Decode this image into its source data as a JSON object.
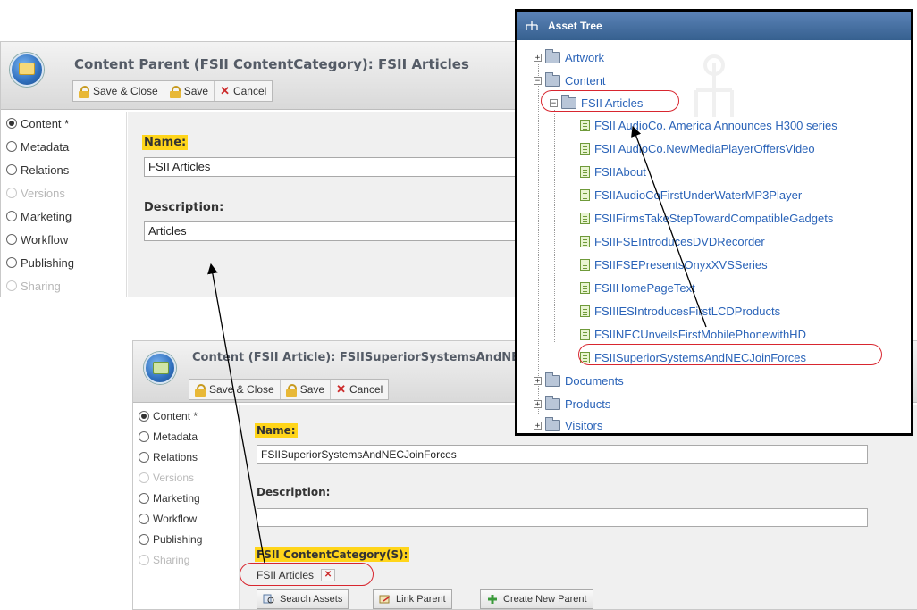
{
  "parent_panel": {
    "title": "Content Parent (FSII ContentCategory): FSII Articles",
    "toolbar": {
      "save_close": "Save & Close",
      "save": "Save",
      "cancel": "Cancel"
    },
    "tabs": [
      "Content *",
      "Metadata",
      "Relations",
      "Versions",
      "Marketing",
      "Workflow",
      "Publishing",
      "Sharing"
    ],
    "name_label": "Name:",
    "name_value": "FSII Articles",
    "description_label": "Description:",
    "description_value": "Articles"
  },
  "article_panel": {
    "title": "Content (FSII Article): FSIISuperiorSystemsAndNECJoinForces",
    "toolbar": {
      "save_close": "Save & Close",
      "save": "Save",
      "cancel": "Cancel"
    },
    "tabs": [
      "Content *",
      "Metadata",
      "Relations",
      "Versions",
      "Marketing",
      "Workflow",
      "Publishing",
      "Sharing"
    ],
    "name_label": "Name:",
    "name_value": "FSIISuperiorSystemsAndNECJoinForces",
    "description_label": "Description:",
    "description_value": "",
    "category_label": "FSII ContentCategory(S):",
    "category_chip": "FSII Articles",
    "buttons": {
      "search": "Search Assets",
      "link": "Link Parent",
      "create": "Create New Parent"
    }
  },
  "asset_tree": {
    "title": "Asset Tree",
    "roots": [
      {
        "label": "Artwork",
        "expanded": false
      },
      {
        "label": "Content",
        "expanded": true
      },
      {
        "label": "Documents",
        "expanded": false
      },
      {
        "label": "Products",
        "expanded": false
      },
      {
        "label": "Visitors",
        "expanded": false
      }
    ],
    "content_child": "FSII Articles",
    "articles": [
      "FSII AudioCo. America Announces H300 series",
      "FSII AudioCo.NewMediaPlayerOffersVideo",
      "FSIIAbout",
      "FSIIAudioCoFirstUnderWaterMP3Player",
      "FSIIFirmsTakeStepTowardCompatibleGadgets",
      "FSIIFSEIntroducesDVDRecorder",
      "FSIIFSEPresentsOnyxXVSSeries",
      "FSIIHomePageText",
      "FSIIIESIntroducesFirstLCDProducts",
      "FSIINECUnveilsFirstMobilePhonewithHD",
      "FSIISuperiorSystemsAndNECJoinForces"
    ]
  },
  "colors": {
    "highlight": "#ffd51a",
    "tree_link": "#2a63b8",
    "annotation_red": "#d8262f",
    "tree_header": "#36608f"
  }
}
